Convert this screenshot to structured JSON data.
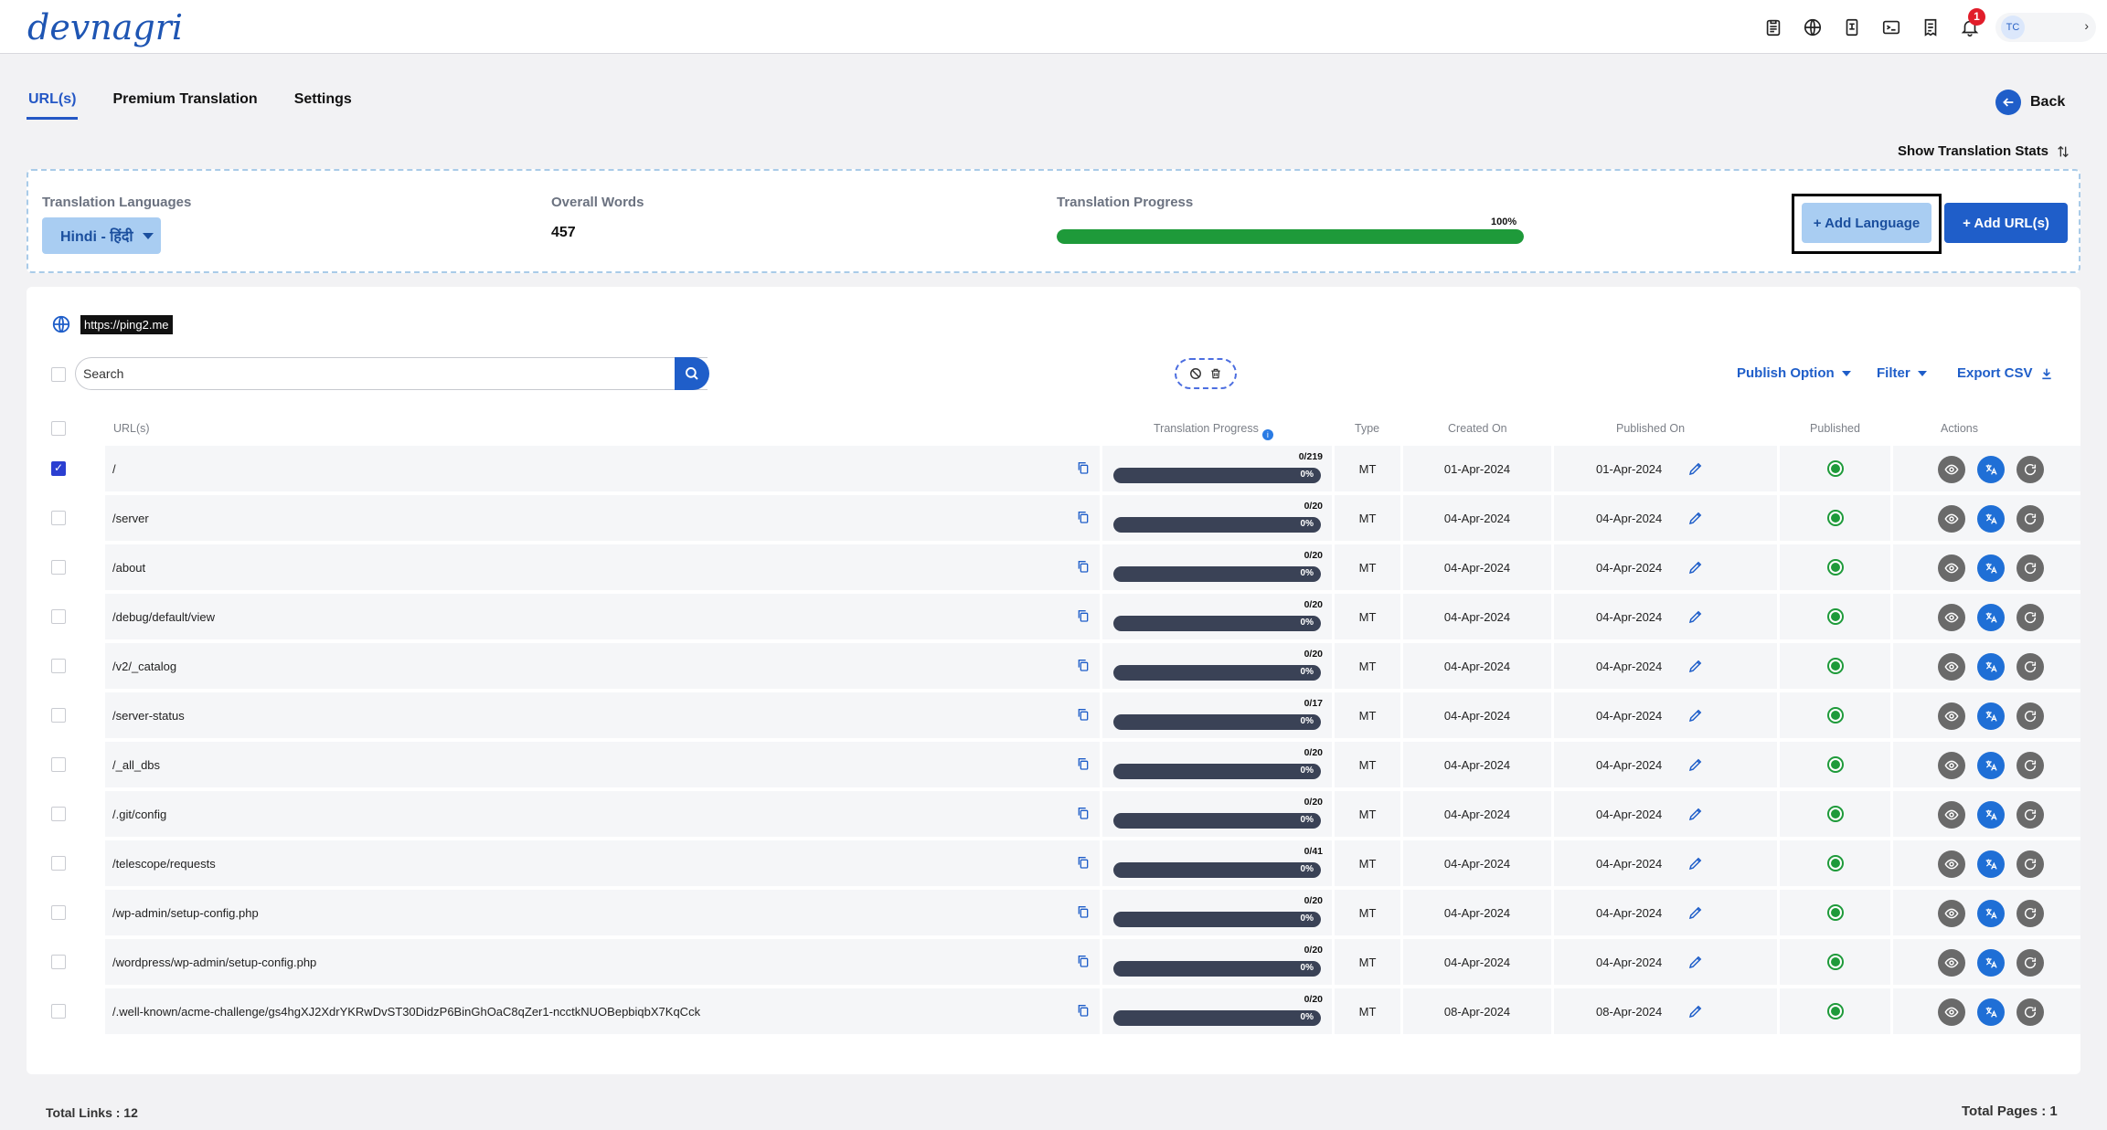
{
  "app": {
    "logo_text": "devnagri"
  },
  "topbar": {
    "icons": [
      "clipboard-icon",
      "globe-icon",
      "document-translate-icon",
      "terminal-icon",
      "invoice-icon",
      "bell-icon"
    ],
    "notification_count": "1",
    "user_initials": "TC"
  },
  "tabs": [
    {
      "label": "URL(s)",
      "active": true
    },
    {
      "label": "Premium Translation",
      "active": false
    },
    {
      "label": "Settings",
      "active": false
    }
  ],
  "back_label": "Back",
  "stats_toggle_label": "Show Translation Stats",
  "summary": {
    "languages_label": "Translation Languages",
    "selected_language": "Hindi - हिंदी",
    "overall_words_label": "Overall Words",
    "overall_words_value": "457",
    "progress_label": "Translation Progress",
    "progress_percent_text": "100%",
    "progress_fraction": 1.0,
    "add_language_label": "+ Add Language",
    "add_url_label": "+ Add URL(s)"
  },
  "domain": {
    "url": "https://ping2.me"
  },
  "toolbar": {
    "search_placeholder": "Search",
    "publish_option_label": "Publish Option",
    "filter_label": "Filter",
    "export_csv_label": "Export CSV"
  },
  "table": {
    "columns": {
      "urls": "URL(s)",
      "progress": "Translation Progress",
      "type": "Type",
      "created": "Created On",
      "published_on": "Published On",
      "published": "Published",
      "actions": "Actions"
    },
    "rows": [
      {
        "checked": true,
        "url": "/",
        "count": "0/219",
        "pct": "0%",
        "type": "MT",
        "created": "01-Apr-2024",
        "published_on": "01-Apr-2024"
      },
      {
        "checked": false,
        "url": "/server",
        "count": "0/20",
        "pct": "0%",
        "type": "MT",
        "created": "04-Apr-2024",
        "published_on": "04-Apr-2024"
      },
      {
        "checked": false,
        "url": "/about",
        "count": "0/20",
        "pct": "0%",
        "type": "MT",
        "created": "04-Apr-2024",
        "published_on": "04-Apr-2024"
      },
      {
        "checked": false,
        "url": "/debug/default/view",
        "count": "0/20",
        "pct": "0%",
        "type": "MT",
        "created": "04-Apr-2024",
        "published_on": "04-Apr-2024"
      },
      {
        "checked": false,
        "url": "/v2/_catalog",
        "count": "0/20",
        "pct": "0%",
        "type": "MT",
        "created": "04-Apr-2024",
        "published_on": "04-Apr-2024"
      },
      {
        "checked": false,
        "url": "/server-status",
        "count": "0/17",
        "pct": "0%",
        "type": "MT",
        "created": "04-Apr-2024",
        "published_on": "04-Apr-2024"
      },
      {
        "checked": false,
        "url": "/_all_dbs",
        "count": "0/20",
        "pct": "0%",
        "type": "MT",
        "created": "04-Apr-2024",
        "published_on": "04-Apr-2024"
      },
      {
        "checked": false,
        "url": "/.git/config",
        "count": "0/20",
        "pct": "0%",
        "type": "MT",
        "created": "04-Apr-2024",
        "published_on": "04-Apr-2024"
      },
      {
        "checked": false,
        "url": "/telescope/requests",
        "count": "0/41",
        "pct": "0%",
        "type": "MT",
        "created": "04-Apr-2024",
        "published_on": "04-Apr-2024"
      },
      {
        "checked": false,
        "url": "/wp-admin/setup-config.php",
        "count": "0/20",
        "pct": "0%",
        "type": "MT",
        "created": "04-Apr-2024",
        "published_on": "04-Apr-2024"
      },
      {
        "checked": false,
        "url": "/wordpress/wp-admin/setup-config.php",
        "count": "0/20",
        "pct": "0%",
        "type": "MT",
        "created": "04-Apr-2024",
        "published_on": "04-Apr-2024"
      },
      {
        "checked": false,
        "url": "/.well-known/acme-challenge/gs4hgXJ2XdrYKRwDvST30DidzP6BinGhOaC8qZer1-ncctkNUOBepbiqbX7KqCck",
        "count": "0/20",
        "pct": "0%",
        "type": "MT",
        "created": "08-Apr-2024",
        "published_on": "08-Apr-2024"
      }
    ]
  },
  "footer": {
    "total_links": "Total Links : 12",
    "total_pages": "Total Pages : 1"
  },
  "colors": {
    "primary": "#1f5ec9",
    "accent_light": "#a9cdf2",
    "success": "#1e9a3a",
    "progress_track": "#3a4256"
  }
}
